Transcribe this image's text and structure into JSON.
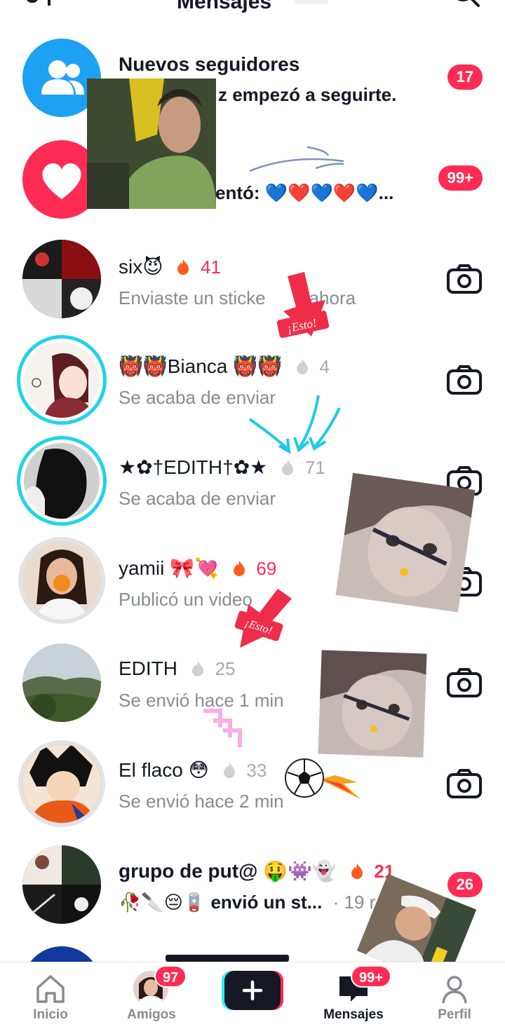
{
  "header": {
    "left_glyph": "↑",
    "title": "Mensajes"
  },
  "rows": [
    {
      "name": "Nuevos seguidores",
      "sub": "z empezó a seguirte.",
      "badge": "17"
    },
    {
      "name": "",
      "sub": "entó: 💙❤️💙❤️💙...",
      "badge": "99+"
    },
    {
      "name": "six😈",
      "streak": "41",
      "sub": "Enviaste un sticke",
      "sub2": "ahora"
    },
    {
      "name": "👹👹Bianca 👹👹",
      "streak": "4",
      "sub": "Se acaba de enviar"
    },
    {
      "name": "★✿†EDITH†✿★",
      "streak": "71",
      "sub": "Se acaba de enviar"
    },
    {
      "name": "yamii 🎀💘",
      "streak": "69",
      "sub": "Publicó un video"
    },
    {
      "name": "EDITH",
      "streak": "25",
      "sub": "Se envió hace 1 min"
    },
    {
      "name": "El flaco 😳",
      "streak": "33",
      "sub": "Se envió hace 2 min"
    },
    {
      "name": "grupo de put@ 🤑👾👻",
      "streak": "21",
      "sub": "🥀🔪😔🪫 envió un st...",
      "time": "· 19 r",
      "badge": "26"
    }
  ],
  "stickers": {
    "esto_1": "¡Esto!",
    "esto_2": "¡Esto!"
  },
  "nav": {
    "home": "Inicio",
    "friends": "Amigos",
    "friends_badge": "97",
    "messages": "Mensajes",
    "messages_badge": "99+",
    "profile": "Perfil"
  },
  "colors": {
    "accent": "#fe2c55",
    "cyan": "#1fd4e8",
    "followers_blue": "#1da1f2",
    "secondary_text": "#8a8b91"
  }
}
